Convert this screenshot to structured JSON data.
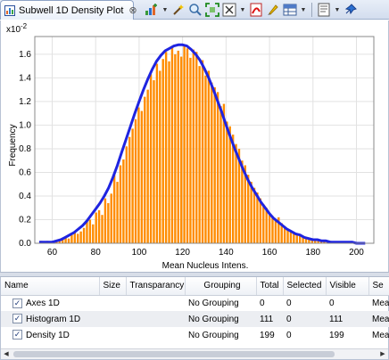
{
  "tab": {
    "label": "Subwell 1D Density Plot",
    "close": "⊗",
    "icon": "chart-icon"
  },
  "toolbar": {
    "icons": [
      "add-layer-icon",
      "wand-icon",
      "zoom-icon",
      "fit-icon",
      "axis-icon",
      "pdf-icon",
      "brush-icon",
      "table-icon",
      "settings-icon",
      "pin-icon"
    ]
  },
  "chart": {
    "ylabel": "Frequency",
    "xlabel": "Mean Nucleus Intens.",
    "y_exponent_base": "x10",
    "y_exponent_power": "-2",
    "y_ticks": [
      "0.0",
      "0.2",
      "0.4",
      "0.6",
      "0.8",
      "1.0",
      "1.2",
      "1.4",
      "1.6"
    ],
    "x_ticks": [
      "60",
      "80",
      "100",
      "120",
      "140",
      "160",
      "180",
      "200"
    ]
  },
  "chart_data": {
    "type": "bar",
    "xlabel": "Mean Nucleus Intens.",
    "ylabel": "Frequency",
    "y_multiplier": "x10^-2",
    "xlim": [
      52,
      208
    ],
    "ylim": [
      0,
      1.75
    ],
    "grid": true,
    "histogram": {
      "color": "#ff8c00",
      "bin_width": 1.4,
      "x": [
        55,
        56.4,
        57.8,
        59.2,
        60.6,
        62,
        63.4,
        64.8,
        66.2,
        67.6,
        69,
        70.4,
        71.8,
        73.2,
        74.6,
        76,
        77.4,
        78.8,
        80.2,
        81.6,
        83,
        84.4,
        85.8,
        87.2,
        88.6,
        90,
        91.4,
        92.8,
        94.2,
        95.6,
        97,
        98.4,
        99.8,
        101.2,
        102.6,
        104,
        105.4,
        106.8,
        108.2,
        109.6,
        111,
        112.4,
        113.8,
        115.2,
        116.6,
        118,
        119.4,
        120.8,
        122.2,
        123.6,
        125,
        126.4,
        127.8,
        129.2,
        130.6,
        132,
        133.4,
        134.8,
        136.2,
        137.6,
        139,
        140.4,
        141.8,
        143.2,
        144.6,
        146,
        147.4,
        148.8,
        150.2,
        151.6,
        153,
        154.4,
        155.8,
        157.2,
        158.6,
        160,
        161.4,
        162.8,
        164.2,
        165.6,
        167,
        168.4,
        169.8,
        171.2,
        172.6,
        174,
        175.4,
        176.8,
        178.2,
        179.6,
        181,
        182.4,
        183.8,
        185.2,
        186.6,
        188,
        189.4,
        190.8,
        192.2,
        193.6,
        195,
        196.4,
        197.8,
        199.2,
        200.6,
        202,
        203.4,
        204.8
      ],
      "values": [
        0.02,
        0.01,
        0.02,
        0.01,
        0.02,
        0.02,
        0.03,
        0.04,
        0.05,
        0.04,
        0.07,
        0.09,
        0.08,
        0.1,
        0.13,
        0.18,
        0.2,
        0.16,
        0.26,
        0.28,
        0.24,
        0.38,
        0.34,
        0.42,
        0.58,
        0.52,
        0.66,
        0.71,
        0.82,
        0.9,
        0.97,
        1.05,
        1.15,
        1.12,
        1.24,
        1.3,
        1.43,
        1.38,
        1.52,
        1.46,
        1.56,
        1.62,
        1.54,
        1.67,
        1.6,
        1.63,
        1.58,
        1.68,
        1.65,
        1.57,
        1.64,
        1.62,
        1.5,
        1.55,
        1.42,
        1.46,
        1.36,
        1.32,
        1.28,
        1.16,
        1.18,
        1.03,
        0.99,
        0.92,
        0.84,
        0.8,
        0.7,
        0.66,
        0.58,
        0.52,
        0.47,
        0.43,
        0.38,
        0.33,
        0.3,
        0.24,
        0.23,
        0.2,
        0.22,
        0.17,
        0.14,
        0.12,
        0.1,
        0.09,
        0.08,
        0.07,
        0.05,
        0.05,
        0.04,
        0.03,
        0.03,
        0.02,
        0.02,
        0.02,
        0.01,
        0.02,
        0.01,
        0.01,
        0.01,
        0.01,
        0.01,
        0.0,
        0.01,
        0.0,
        0.0,
        0.01,
        0.0,
        0.0
      ]
    },
    "density": {
      "color": "#1f24e0",
      "x": [
        54,
        56,
        58,
        60,
        62,
        64,
        66,
        68,
        70,
        72,
        74,
        76,
        78,
        80,
        82,
        84,
        86,
        88,
        90,
        92,
        94,
        96,
        98,
        100,
        102,
        104,
        106,
        108,
        110,
        112,
        114,
        116,
        118,
        120,
        122,
        124,
        126,
        128,
        130,
        132,
        134,
        136,
        138,
        140,
        142,
        144,
        146,
        148,
        150,
        152,
        154,
        156,
        158,
        160,
        162,
        164,
        166,
        168,
        170,
        172,
        174,
        176,
        178,
        180,
        182,
        184,
        186,
        188,
        190,
        192,
        194,
        196,
        198,
        200,
        202,
        204
      ],
      "values": [
        0.01,
        0.01,
        0.01,
        0.01,
        0.02,
        0.03,
        0.05,
        0.07,
        0.09,
        0.12,
        0.15,
        0.19,
        0.24,
        0.29,
        0.34,
        0.4,
        0.47,
        0.56,
        0.66,
        0.77,
        0.88,
        0.99,
        1.1,
        1.2,
        1.3,
        1.39,
        1.47,
        1.54,
        1.59,
        1.63,
        1.65,
        1.67,
        1.68,
        1.68,
        1.67,
        1.64,
        1.6,
        1.55,
        1.48,
        1.4,
        1.31,
        1.21,
        1.11,
        1.0,
        0.9,
        0.8,
        0.71,
        0.62,
        0.54,
        0.47,
        0.41,
        0.35,
        0.3,
        0.25,
        0.21,
        0.18,
        0.15,
        0.12,
        0.1,
        0.08,
        0.07,
        0.05,
        0.04,
        0.03,
        0.03,
        0.02,
        0.02,
        0.01,
        0.01,
        0.01,
        0.01,
        0.01,
        0.01,
        0.0,
        0.0,
        0.0
      ]
    }
  },
  "table": {
    "columns": [
      "Name",
      "Size",
      "Transparancy",
      "Grouping",
      "Total",
      "Selected",
      "Visible",
      "Se"
    ],
    "rows": [
      {
        "checked": "✓",
        "name": "Axes 1D",
        "size": "",
        "transparency": "",
        "grouping": "No Grouping",
        "total": "0",
        "selected": "0",
        "visible": "0",
        "se": "Mea"
      },
      {
        "checked": "✓",
        "name": "Histogram 1D",
        "size": "",
        "transparency": "",
        "grouping": "No Grouping",
        "total": "111",
        "selected": "0",
        "visible": "111",
        "se": "Mea"
      },
      {
        "checked": "✓",
        "name": "Density 1D",
        "size": "",
        "transparency": "",
        "grouping": "No Grouping",
        "total": "199",
        "selected": "0",
        "visible": "199",
        "se": "Mea"
      }
    ]
  }
}
